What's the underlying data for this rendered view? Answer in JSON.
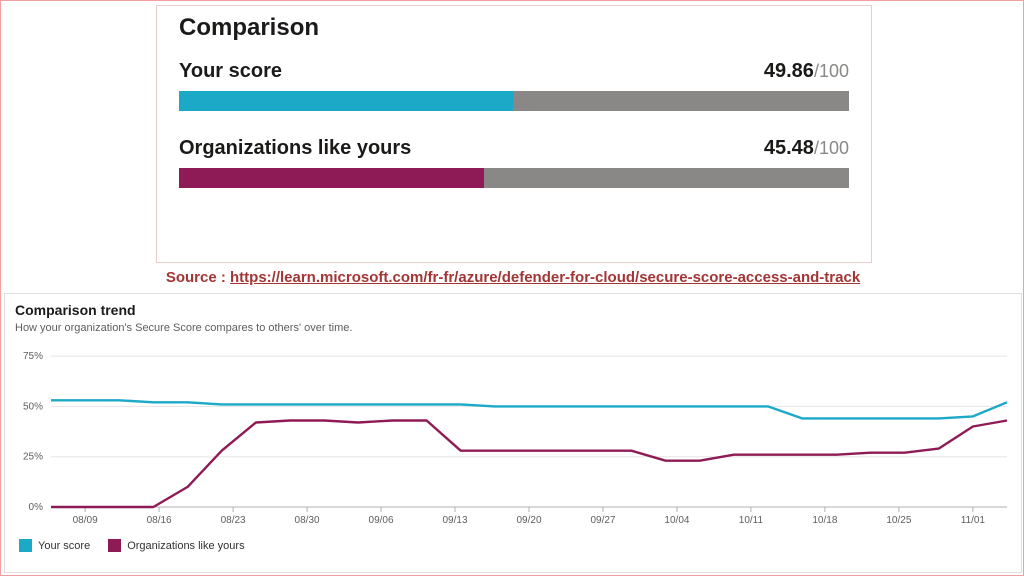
{
  "colors": {
    "your_score": "#1ca8c7",
    "org_score": "#8e1b55",
    "track": "#8a8886"
  },
  "comparison": {
    "title": "Comparison",
    "rows": [
      {
        "label": "Your score",
        "value": "49.86",
        "max": "100",
        "pct": 49.86,
        "color_key": "your_score"
      },
      {
        "label": "Organizations like yours",
        "value": "45.48",
        "max": "100",
        "pct": 45.48,
        "color_key": "org_score"
      }
    ]
  },
  "source": {
    "prefix": "Source : ",
    "text": "https://learn.microsoft.com/fr-fr/azure/defender-for-cloud/secure-score-access-and-track"
  },
  "trend": {
    "title": "Comparison trend",
    "subtitle": "How your organization's Secure Score compares to others' over time.",
    "legend": [
      {
        "label": "Your score",
        "color_key": "your_score"
      },
      {
        "label": "Organizations like yours",
        "color_key": "org_score"
      }
    ]
  },
  "chart_data": {
    "type": "line",
    "xlabel": "",
    "ylabel": "",
    "ylim": [
      0,
      80
    ],
    "y_ticks": [
      0,
      25,
      50,
      75
    ],
    "y_tick_labels": [
      "0%",
      "25%",
      "50%",
      "75%"
    ],
    "x_tick_labels": [
      "08/09",
      "08/16",
      "08/23",
      "08/30",
      "09/06",
      "09/13",
      "09/20",
      "09/27",
      "10/04",
      "10/11",
      "10/18",
      "10/25",
      "11/01"
    ],
    "x": [
      0,
      1,
      2,
      3,
      4,
      5,
      6,
      7,
      8,
      9,
      10,
      11,
      12,
      13,
      14,
      15,
      16,
      17,
      18,
      19,
      20,
      21,
      22,
      23,
      24,
      25,
      26,
      27,
      28
    ],
    "series": [
      {
        "name": "Your score",
        "color_key": "your_score",
        "values": [
          53,
          53,
          53,
          52,
          52,
          51,
          51,
          51,
          51,
          51,
          51,
          51,
          51,
          50,
          50,
          50,
          50,
          50,
          50,
          50,
          50,
          50,
          44,
          44,
          44,
          44,
          44,
          45,
          52
        ]
      },
      {
        "name": "Organizations like yours",
        "color_key": "org_score",
        "values": [
          0,
          0,
          0,
          0,
          10,
          28,
          42,
          43,
          43,
          42,
          43,
          43,
          28,
          28,
          28,
          28,
          28,
          28,
          23,
          23,
          26,
          26,
          26,
          26,
          27,
          27,
          29,
          40,
          43
        ]
      }
    ]
  }
}
